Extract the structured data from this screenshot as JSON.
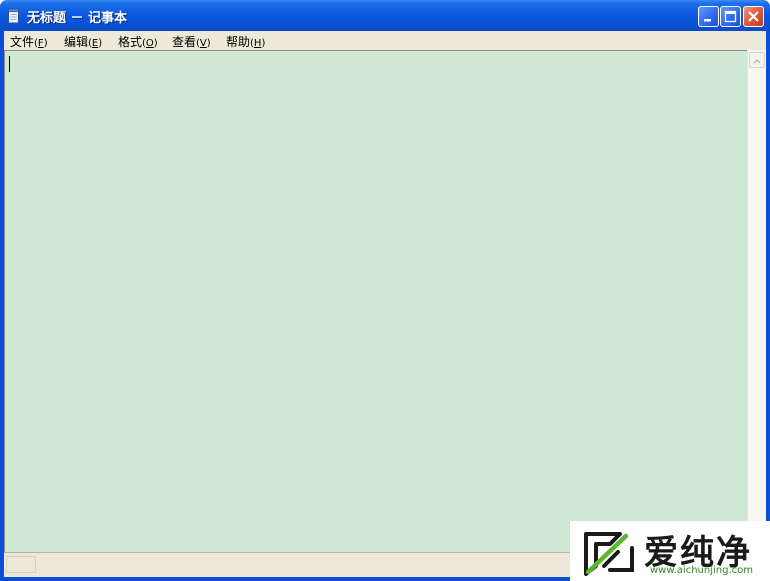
{
  "window": {
    "title": "无标题 － 记事本",
    "icon": "notepad-icon",
    "controls": {
      "minimize": "minimize-icon",
      "maximize": "maximize-icon",
      "close": "close-icon"
    },
    "title_color": "#0a54d8"
  },
  "menu": {
    "items": [
      {
        "label": "文件",
        "key": "(F)",
        "key_letter": "F"
      },
      {
        "label": "编辑",
        "key": "(E)",
        "key_letter": "E"
      },
      {
        "label": "格式",
        "key": "(O)",
        "key_letter": "O"
      },
      {
        "label": "查看",
        "key": "(V)",
        "key_letter": "V"
      },
      {
        "label": "帮助",
        "key": "(H)",
        "key_letter": "H"
      }
    ]
  },
  "editor": {
    "text": "",
    "background": "#cfe8d4"
  },
  "watermark": {
    "name": "爱纯净",
    "url": "www.aichunjing.com",
    "accent": "#5cb82b"
  }
}
